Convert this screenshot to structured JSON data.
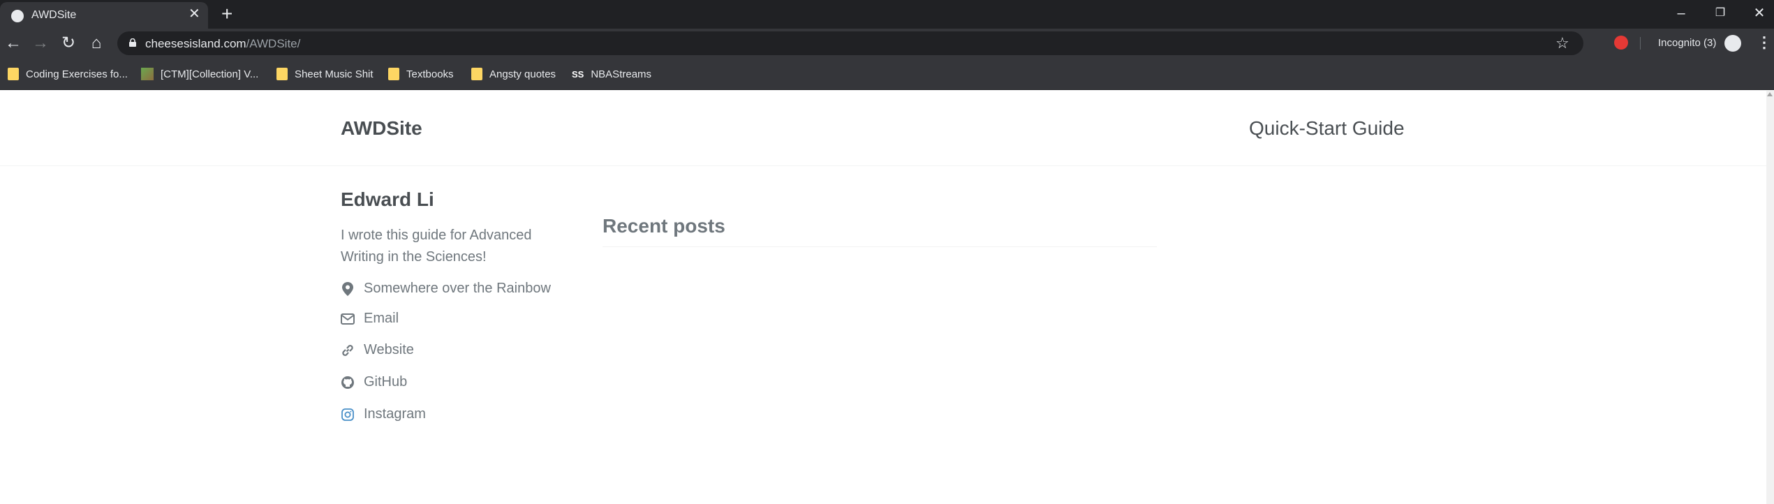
{
  "browser": {
    "tab_title": "AWDSite",
    "url_host": "cheesesisland.com",
    "url_path": "/AWDSite/",
    "incognito_label": "Incognito (3)",
    "bookmarks": [
      {
        "label": "Coding Exercises fo...",
        "icon": "folder-icon"
      },
      {
        "label": "[CTM][Collection] V...",
        "icon": "cube-icon"
      },
      {
        "label": "Sheet Music Shit",
        "icon": "folder-icon"
      },
      {
        "label": "Textbooks",
        "icon": "folder-icon"
      },
      {
        "label": "Angsty quotes",
        "icon": "folder-icon"
      },
      {
        "label": "NBAStreams",
        "icon": "ss-icon",
        "icon_text": "SS"
      }
    ]
  },
  "site": {
    "title": "AWDSite",
    "nav_link": "Quick-Start Guide"
  },
  "author": {
    "name": "Edward Li",
    "bio": "I wrote this guide for Advanced Writing in the Sciences!",
    "links": [
      {
        "label": "Somewhere over the Rainbow",
        "icon": "map-marker-icon"
      },
      {
        "label": "Email",
        "icon": "envelope-icon"
      },
      {
        "label": "Website",
        "icon": "link-icon"
      },
      {
        "label": "GitHub",
        "icon": "github-icon"
      },
      {
        "label": "Instagram",
        "icon": "instagram-icon"
      }
    ]
  },
  "main": {
    "recent_title": "Recent posts"
  }
}
